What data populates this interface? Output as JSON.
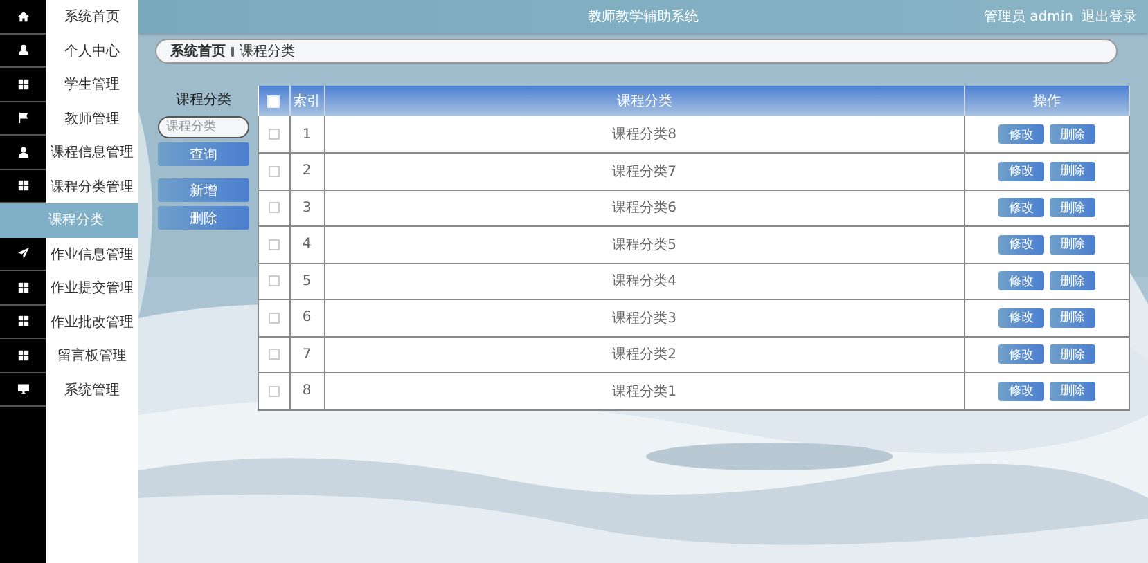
{
  "header": {
    "title": "教师教学辅助系统",
    "user": "管理员 admin",
    "logout": "退出登录"
  },
  "menu": [
    {
      "label": "系统首页",
      "kind": "main",
      "selected": false
    },
    {
      "label": "个人中心",
      "kind": "main",
      "selected": false
    },
    {
      "label": "学生管理",
      "kind": "main",
      "selected": false
    },
    {
      "label": "教师管理",
      "kind": "main",
      "selected": false
    },
    {
      "label": "课程信息管理",
      "kind": "main",
      "selected": false
    },
    {
      "label": "课程分类管理",
      "kind": "main",
      "selected": false
    },
    {
      "label": "课程分类",
      "kind": "sub",
      "selected": true
    },
    {
      "label": "作业信息管理",
      "kind": "main",
      "selected": false
    },
    {
      "label": "作业提交管理",
      "kind": "main",
      "selected": false
    },
    {
      "label": "作业批改管理",
      "kind": "main",
      "selected": false
    },
    {
      "label": "留言板管理",
      "kind": "main",
      "selected": false
    },
    {
      "label": "系统管理",
      "kind": "main",
      "selected": false
    }
  ],
  "breadcrumb": [
    "系统首页",
    "课程分类"
  ],
  "search": {
    "label": "课程分类",
    "placeholder": "课程分类",
    "query_button": "查询",
    "add_button": "新增",
    "delete_button": "删除"
  },
  "table": {
    "columns": [
      "索引",
      "课程分类",
      "操作"
    ],
    "header_checked": false,
    "rows": [
      {
        "index": "1",
        "category": "课程分类8",
        "checked": false,
        "edit": "修改",
        "delete": "删除"
      },
      {
        "index": "2",
        "category": "课程分类7",
        "checked": false,
        "edit": "修改",
        "delete": "删除"
      },
      {
        "index": "3",
        "category": "课程分类6",
        "checked": false,
        "edit": "修改",
        "delete": "删除"
      },
      {
        "index": "4",
        "category": "课程分类5",
        "checked": false,
        "edit": "修改",
        "delete": "删除"
      },
      {
        "index": "5",
        "category": "课程分类4",
        "checked": false,
        "edit": "修改",
        "delete": "删除"
      },
      {
        "index": "6",
        "category": "课程分类3",
        "checked": false,
        "edit": "修改",
        "delete": "删除"
      },
      {
        "index": "7",
        "category": "课程分类2",
        "checked": false,
        "edit": "修改",
        "delete": "删除"
      },
      {
        "index": "8",
        "category": "课程分类1",
        "checked": false,
        "edit": "修改",
        "delete": "删除"
      }
    ]
  }
}
